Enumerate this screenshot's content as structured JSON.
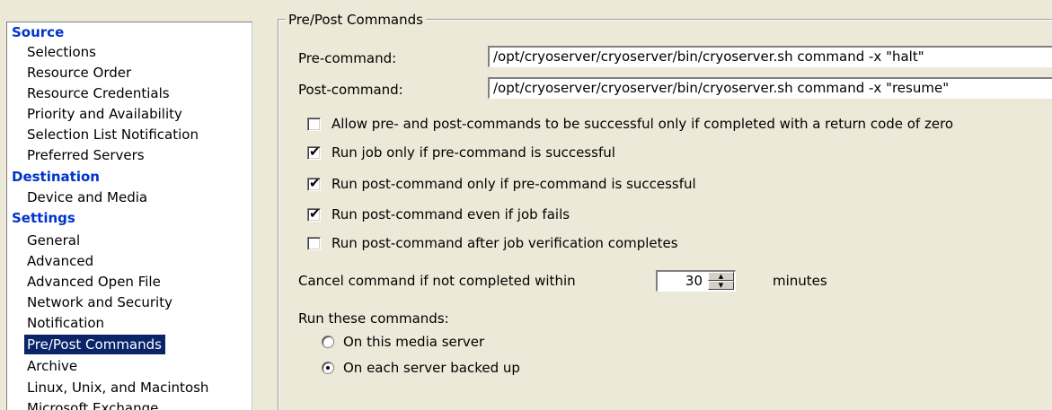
{
  "nav": {
    "sections": [
      {
        "title": "Source",
        "items": [
          "Selections",
          "Resource Order",
          "Resource Credentials",
          "Priority and Availability",
          "Selection List Notification",
          "Preferred Servers"
        ]
      },
      {
        "title": "Destination",
        "items": [
          "Device and Media"
        ]
      },
      {
        "title": "Settings",
        "items": [
          "General",
          "Advanced",
          "Advanced Open File",
          "Network and Security",
          "Notification",
          "Pre/Post Commands",
          "Archive",
          "Linux, Unix, and Macintosh",
          "Microsoft Exchange"
        ]
      }
    ],
    "selected": "Pre/Post Commands"
  },
  "panel": {
    "group_title": "Pre/Post Commands",
    "pre_command_label": "Pre-command:",
    "pre_command_value": "/opt/cryoserver/cryoserver/bin/cryoserver.sh command -x \"halt\"",
    "post_command_label": "Post-command:",
    "post_command_value": "/opt/cryoserver/cryoserver/bin/cryoserver.sh command -x \"resume\"",
    "options": [
      {
        "label": "Allow pre- and post-commands to be successful only if completed with a return code of zero",
        "checked": false
      },
      {
        "label": "Run job only if pre-command is successful",
        "checked": true
      },
      {
        "label": "Run post-command only if pre-command is successful",
        "checked": true
      },
      {
        "label": "Run post-command even if job fails",
        "checked": true
      },
      {
        "label": "Run post-command after job verification completes",
        "checked": false
      }
    ],
    "cancel_label": "Cancel command if not completed within",
    "cancel_value": "30",
    "cancel_unit": "minutes",
    "run_label": "Run these commands:",
    "run_options": [
      {
        "label": "On this media server",
        "selected": false
      },
      {
        "label": "On each server backed up",
        "selected": true
      }
    ]
  },
  "colors": {
    "nav_heading": "#0033cc",
    "selection": "#0a246a",
    "dialog_bg": "#ece9d8"
  }
}
